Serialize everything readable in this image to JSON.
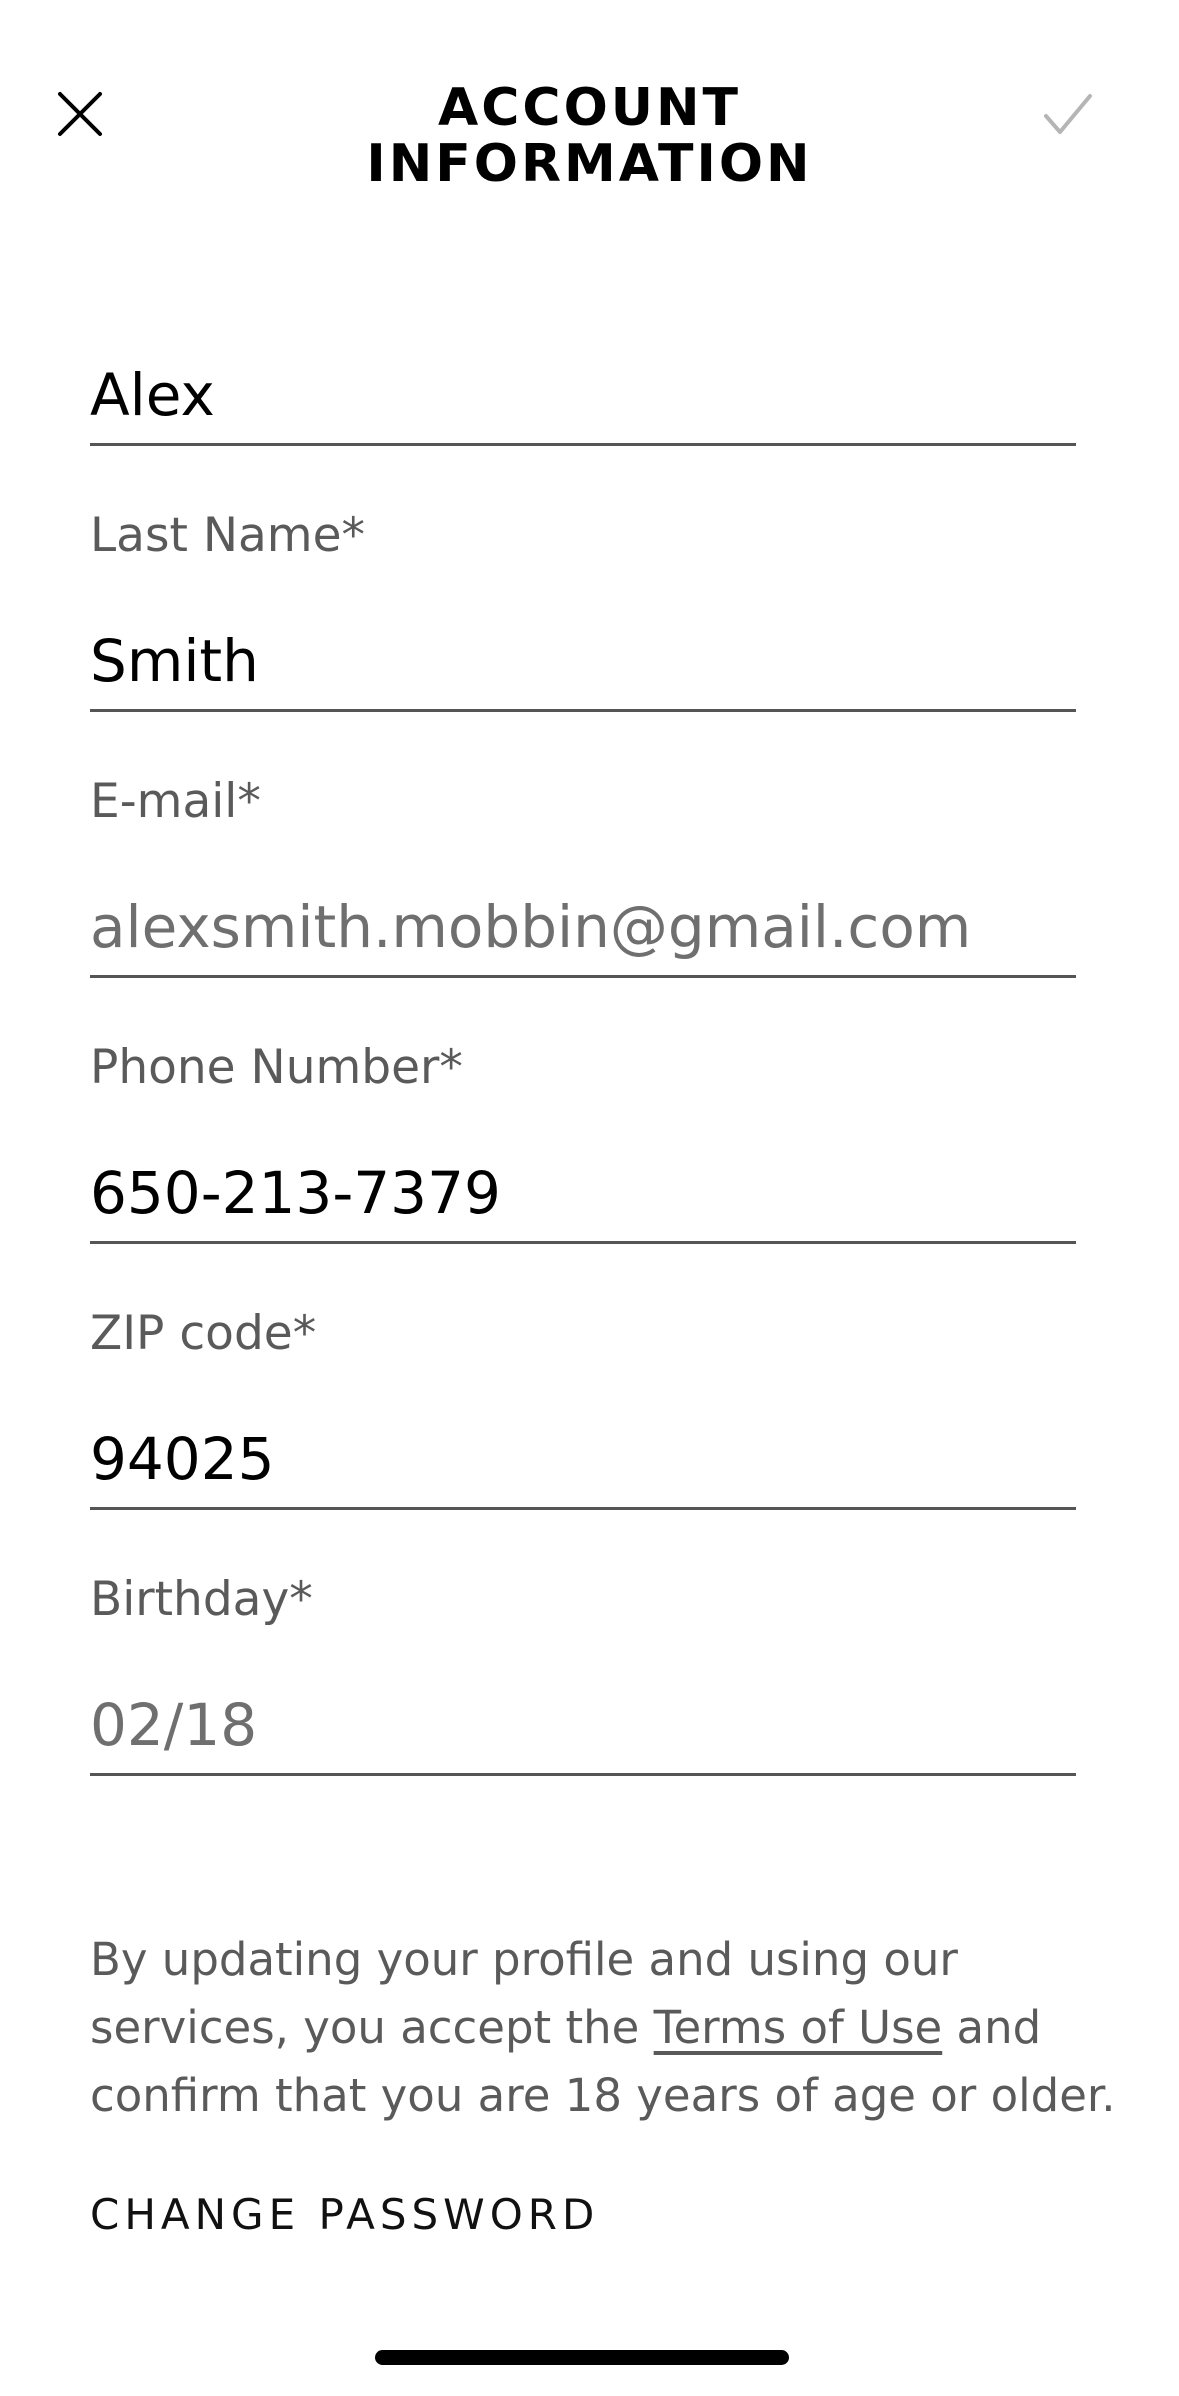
{
  "header": {
    "title_line1": "ACCOUNT",
    "title_line2": "INFORMATION",
    "close_icon": "close-icon",
    "confirm_icon": "checkmark-icon",
    "confirm_color": "#b5b5b5"
  },
  "form": {
    "first_name": {
      "value": "Alex"
    },
    "last_name": {
      "label": "Last Name*",
      "value": "Smith"
    },
    "email": {
      "label": "E-mail*",
      "value": "alexsmith.mobbin@gmail.com"
    },
    "phone": {
      "label": "Phone Number*",
      "value": "650-213-7379"
    },
    "zip": {
      "label": "ZIP code*",
      "value": "94025"
    },
    "birthday": {
      "label": "Birthday*",
      "value": "02/18"
    }
  },
  "terms": {
    "text_before": "By updating your profile and using our services, you accept the ",
    "link_text": "Terms of Use",
    "text_after": " and confirm that you are 18 years of age or older."
  },
  "actions": {
    "change_password": "CHANGE PASSWORD"
  }
}
